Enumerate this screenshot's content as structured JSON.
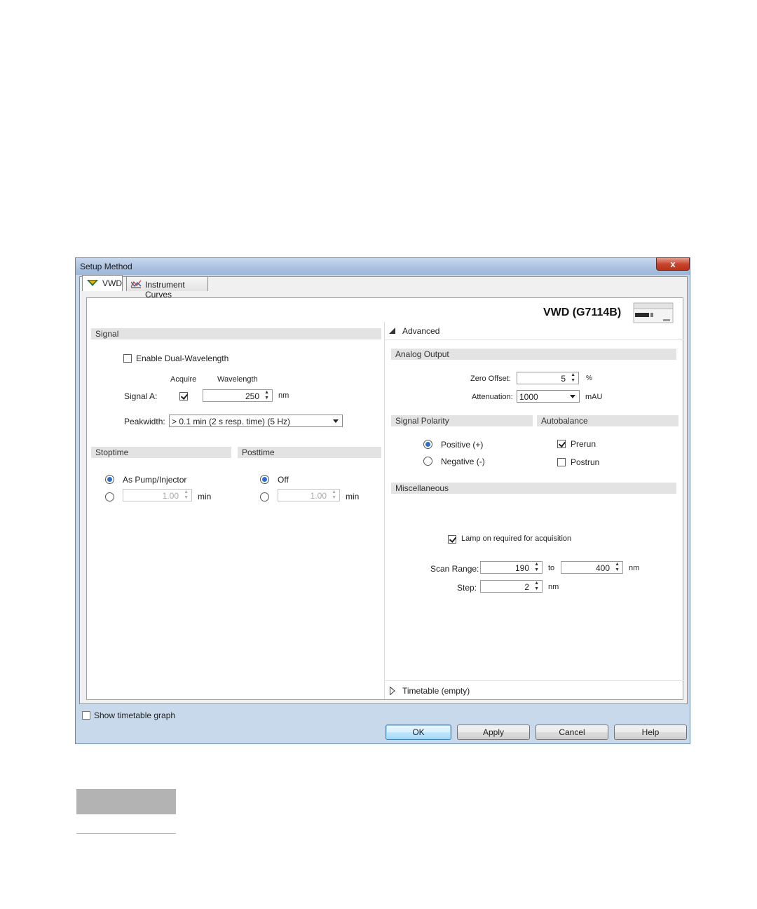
{
  "window": {
    "title": "Setup Method",
    "close_glyph": "x"
  },
  "tabs": [
    {
      "label": "VWD",
      "icon": "vwd-module-icon",
      "active": true
    },
    {
      "label": "Instrument Curves",
      "icon": "instrument-curves-icon",
      "active": false
    }
  ],
  "module": {
    "title": "VWD (G7114B)",
    "image": "vwd-instrument-image"
  },
  "signal": {
    "header": "Signal",
    "dual_wavelength_label": "Enable Dual-Wavelength",
    "dual_wavelength_checked": false,
    "acquire_header": "Acquire",
    "wavelength_header": "Wavelength",
    "signal_a_label": "Signal A:",
    "signal_a_acquire": true,
    "signal_a_wavelength": "250",
    "wavelength_unit": "nm",
    "peakwidth_label": "Peakwidth:",
    "peakwidth_value": "> 0.1 min (2 s resp. time) (5 Hz)"
  },
  "stoptime": {
    "header": "Stoptime",
    "option_pump_label": "As Pump/Injector",
    "option_pump_selected": true,
    "value": "1.00",
    "unit": "min"
  },
  "posttime": {
    "header": "Posttime",
    "option_off_label": "Off",
    "option_off_selected": true,
    "value": "1.00",
    "unit": "min"
  },
  "advanced": {
    "header": "Advanced",
    "analog_output": {
      "header": "Analog Output",
      "zero_offset_label": "Zero Offset:",
      "zero_offset_value": "5",
      "zero_offset_unit": "%",
      "attenuation_label": "Attenuation:",
      "attenuation_value": "1000",
      "attenuation_unit": "mAU"
    },
    "signal_polarity": {
      "header": "Signal Polarity",
      "positive_label": "Positive (+)",
      "negative_label": "Negative (-)",
      "selected": "positive"
    },
    "autobalance": {
      "header": "Autobalance",
      "prerun_label": "Prerun",
      "prerun_checked": true,
      "postrun_label": "Postrun",
      "postrun_checked": false
    },
    "misc": {
      "header": "Miscellaneous",
      "lamp_label": "Lamp on required for acquisition",
      "lamp_checked": true,
      "scan_range_label": "Scan Range:",
      "scan_from": "190",
      "scan_to_label": "to",
      "scan_to": "400",
      "scan_unit": "nm",
      "step_label": "Step:",
      "step_value": "2",
      "step_unit": "nm"
    }
  },
  "timetable": {
    "label": "Timetable (empty)"
  },
  "footer": {
    "show_graph_label": "Show timetable graph",
    "show_graph_checked": false,
    "buttons": {
      "ok": "OK",
      "apply": "Apply",
      "cancel": "Cancel",
      "help": "Help"
    }
  },
  "colors": {
    "accent": "#2a6fc9",
    "titlebar": "#a9c0de",
    "close": "#c8452f"
  }
}
